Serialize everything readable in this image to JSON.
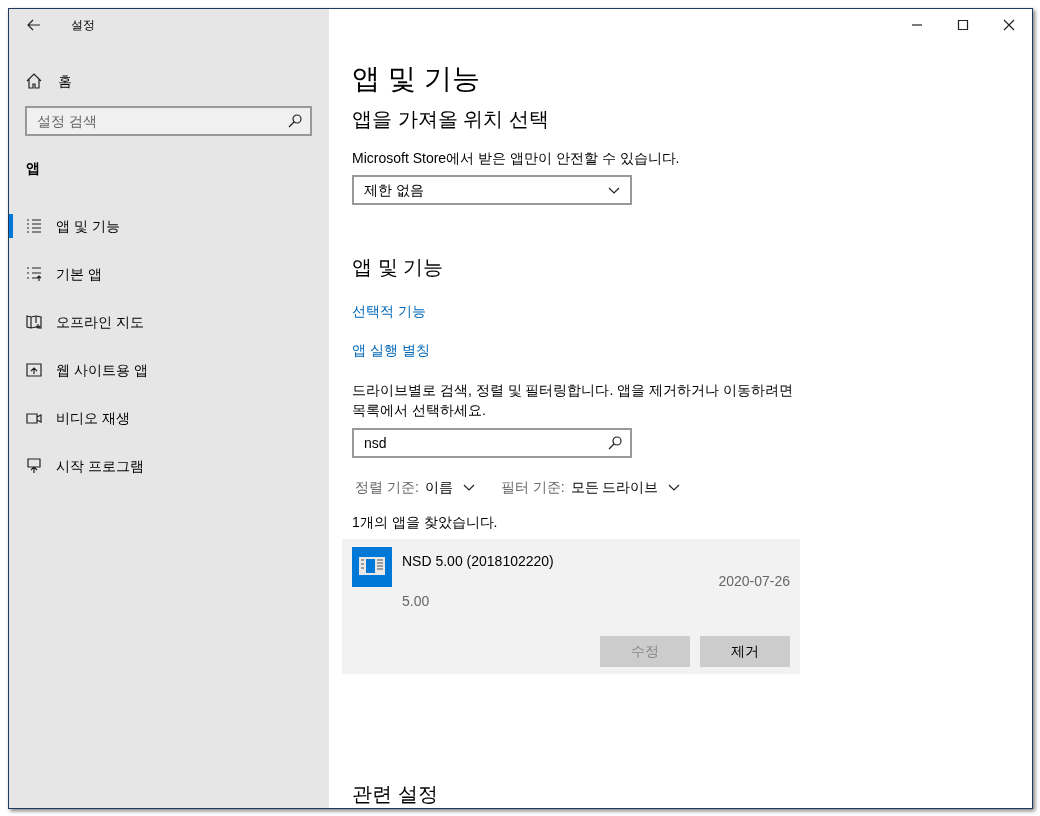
{
  "window": {
    "title": "설정"
  },
  "sidebar": {
    "home": "홈",
    "search": {
      "placeholder": "설정 검색"
    },
    "section": "앱",
    "items": [
      {
        "label": "앱 및 기능",
        "selected": true
      },
      {
        "label": "기본 앱",
        "selected": false
      },
      {
        "label": "오프라인 지도",
        "selected": false
      },
      {
        "label": "웹 사이트용 앱",
        "selected": false
      },
      {
        "label": "비디오 재생",
        "selected": false
      },
      {
        "label": "시작 프로그램",
        "selected": false
      }
    ]
  },
  "main": {
    "title": "앱 및 기능",
    "source": {
      "heading": "앱을 가져올 위치 선택",
      "label": "Microsoft Store에서 받은 앱만이 안전할 수 있습니다.",
      "dropdown": {
        "value": "제한 없음"
      }
    },
    "apps_section": {
      "heading": "앱 및 기능",
      "links": [
        "선택적 기능",
        "앱 실행 별칭"
      ],
      "description": "드라이브별로 검색, 정렬 및 필터링합니다. 앱을 제거하거나 이동하려면 목록에서 선택하세요.",
      "search": {
        "value": "nsd"
      },
      "sort": {
        "label": "정렬 기준:",
        "value": "이름"
      },
      "filter": {
        "label": "필터 기준:",
        "value": "모든 드라이브"
      },
      "result_count": "1개의 앱을 찾았습니다.",
      "apps": [
        {
          "name": "NSD 5.00 (2018102220)",
          "version": "5.00",
          "date": "2020-07-26",
          "buttons": [
            {
              "label": "수정",
              "disabled": true
            },
            {
              "label": "제거",
              "disabled": false
            }
          ]
        }
      ]
    },
    "related_heading": "관련 설정"
  }
}
